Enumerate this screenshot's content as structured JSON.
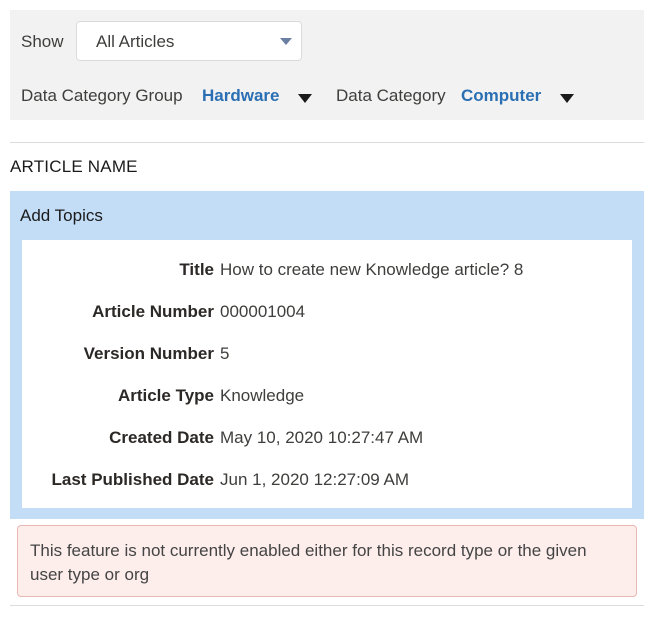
{
  "filters": {
    "show_label": "Show",
    "show_selected": "All Articles",
    "data_category_group_label": "Data Category Group",
    "data_category_group_value": "Hardware",
    "data_category_label": "Data Category",
    "data_category_value": "Computer"
  },
  "table": {
    "column_header": "ARTICLE NAME"
  },
  "article_panel": {
    "title": "Add Topics",
    "fields": [
      {
        "label": "Title",
        "value": "How to create new Knowledge article? 8"
      },
      {
        "label": "Article Number",
        "value": "000001004"
      },
      {
        "label": "Version Number",
        "value": "5"
      },
      {
        "label": "Article Type",
        "value": "Knowledge"
      },
      {
        "label": "Created Date",
        "value": "May 10, 2020 10:27:47 AM"
      },
      {
        "label": "Last Published Date",
        "value": "Jun 1, 2020 12:27:09 AM"
      }
    ]
  },
  "error": {
    "message": "This feature is not currently enabled either for this record type or the given user type or org"
  },
  "icons": {
    "select_caret": "chevron-down-icon",
    "filter_caret": "caret-down-icon"
  },
  "colors": {
    "link_blue": "#2a6fb3",
    "panel_blue": "#c4ddf7",
    "filter_bg": "#f3f2f2",
    "error_bg": "#fdeeec",
    "error_border": "#e8b8b2"
  }
}
